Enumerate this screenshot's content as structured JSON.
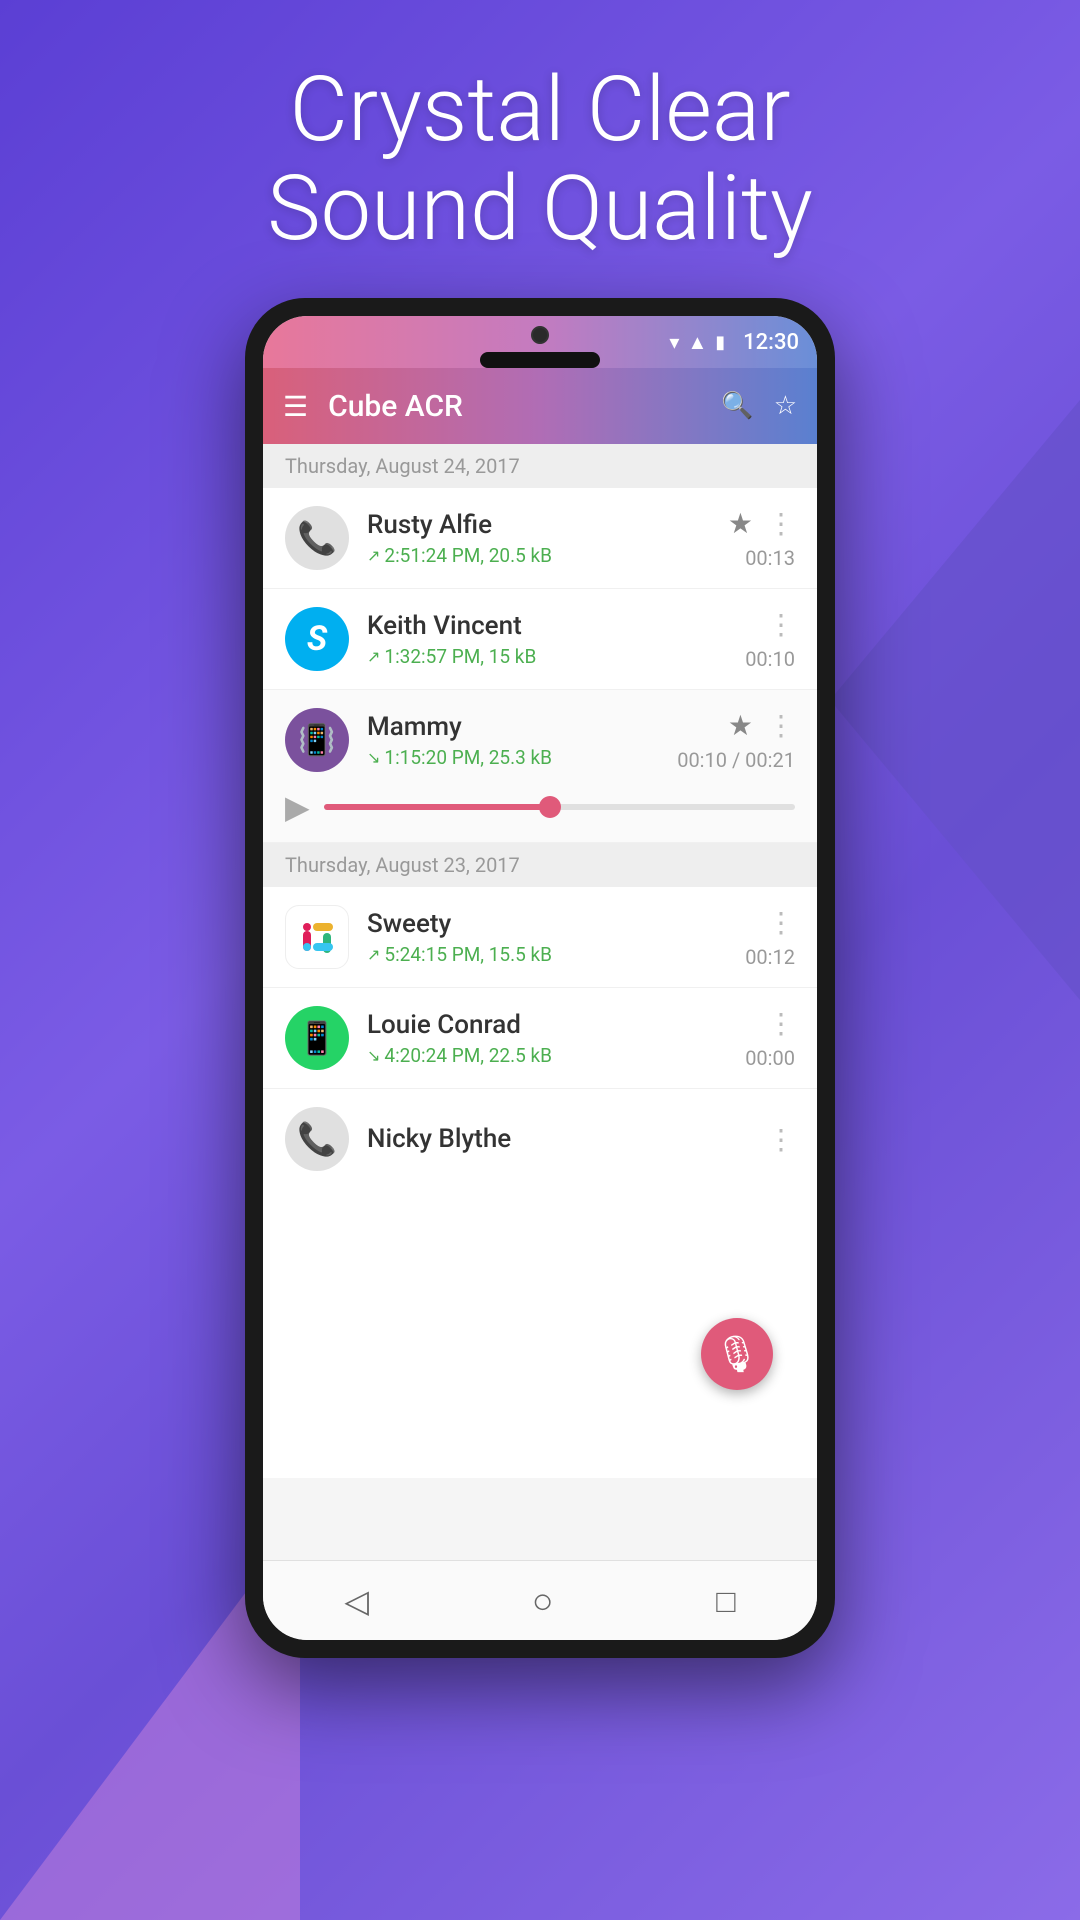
{
  "hero": {
    "line1": "Crystal Clear",
    "line2": "Sound Quality"
  },
  "statusBar": {
    "time": "12:30"
  },
  "appBar": {
    "title": "Cube ACR",
    "menuLabel": "☰",
    "searchLabel": "⚲",
    "starLabel": "☆"
  },
  "sections": [
    {
      "date": "Thursday, August 24, 2017",
      "recordings": [
        {
          "name": "Rusty Alfie",
          "meta": "2:51:24 PM, 20.5 kB",
          "direction": "outgoing",
          "duration": "00:13",
          "starred": true,
          "avatarType": "phone",
          "expanded": false
        },
        {
          "name": "Keith Vincent",
          "meta": "1:32:57 PM, 15 kB",
          "direction": "outgoing",
          "duration": "00:10",
          "starred": false,
          "avatarType": "skype",
          "expanded": false
        },
        {
          "name": "Mammy",
          "meta": "1:15:20 PM, 25.3 kB",
          "direction": "incoming",
          "duration": "00:10 / 00:21",
          "starred": true,
          "avatarType": "viber",
          "expanded": true,
          "progress": 48
        }
      ]
    },
    {
      "date": "Thursday, August 23, 2017",
      "recordings": [
        {
          "name": "Sweety",
          "meta": "5:24:15 PM, 15.5 kB",
          "direction": "outgoing",
          "duration": "00:12",
          "starred": false,
          "avatarType": "slack",
          "expanded": false
        },
        {
          "name": "Louie Conrad",
          "meta": "4:20:24 PM, 22.5 kB",
          "direction": "incoming",
          "duration": "00:00",
          "starred": false,
          "avatarType": "whatsapp",
          "expanded": false
        },
        {
          "name": "Nicky Blythe",
          "meta": "",
          "direction": "outgoing",
          "duration": "",
          "starred": false,
          "avatarType": "phone",
          "expanded": false
        }
      ]
    }
  ],
  "navbar": {
    "back": "◁",
    "home": "○",
    "recents": "□"
  }
}
